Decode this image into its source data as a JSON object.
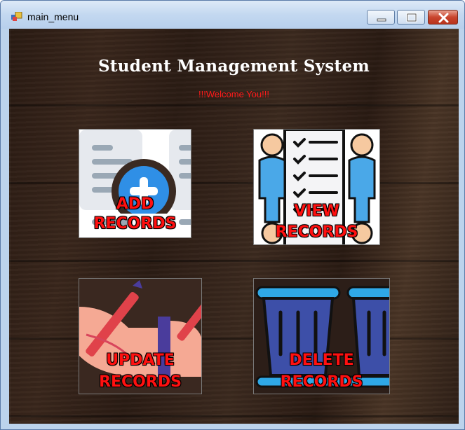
{
  "window": {
    "title": "main_menu"
  },
  "header": {
    "title": "Student Management System",
    "welcome": "!!!Welcome You!!!"
  },
  "tiles": [
    {
      "id": "add",
      "line1": "ADD",
      "line2": "RECORDS"
    },
    {
      "id": "view",
      "line1": "VIEW",
      "line2": "RECORDS"
    },
    {
      "id": "update",
      "line1": "UPDATE",
      "line2": "RECORDS"
    },
    {
      "id": "delete",
      "line1": "DELETE",
      "line2": "RECORDS"
    }
  ],
  "colors": {
    "accent": "#ff1010",
    "welcome": "#ff1a1a",
    "heading": "#ffffff"
  }
}
